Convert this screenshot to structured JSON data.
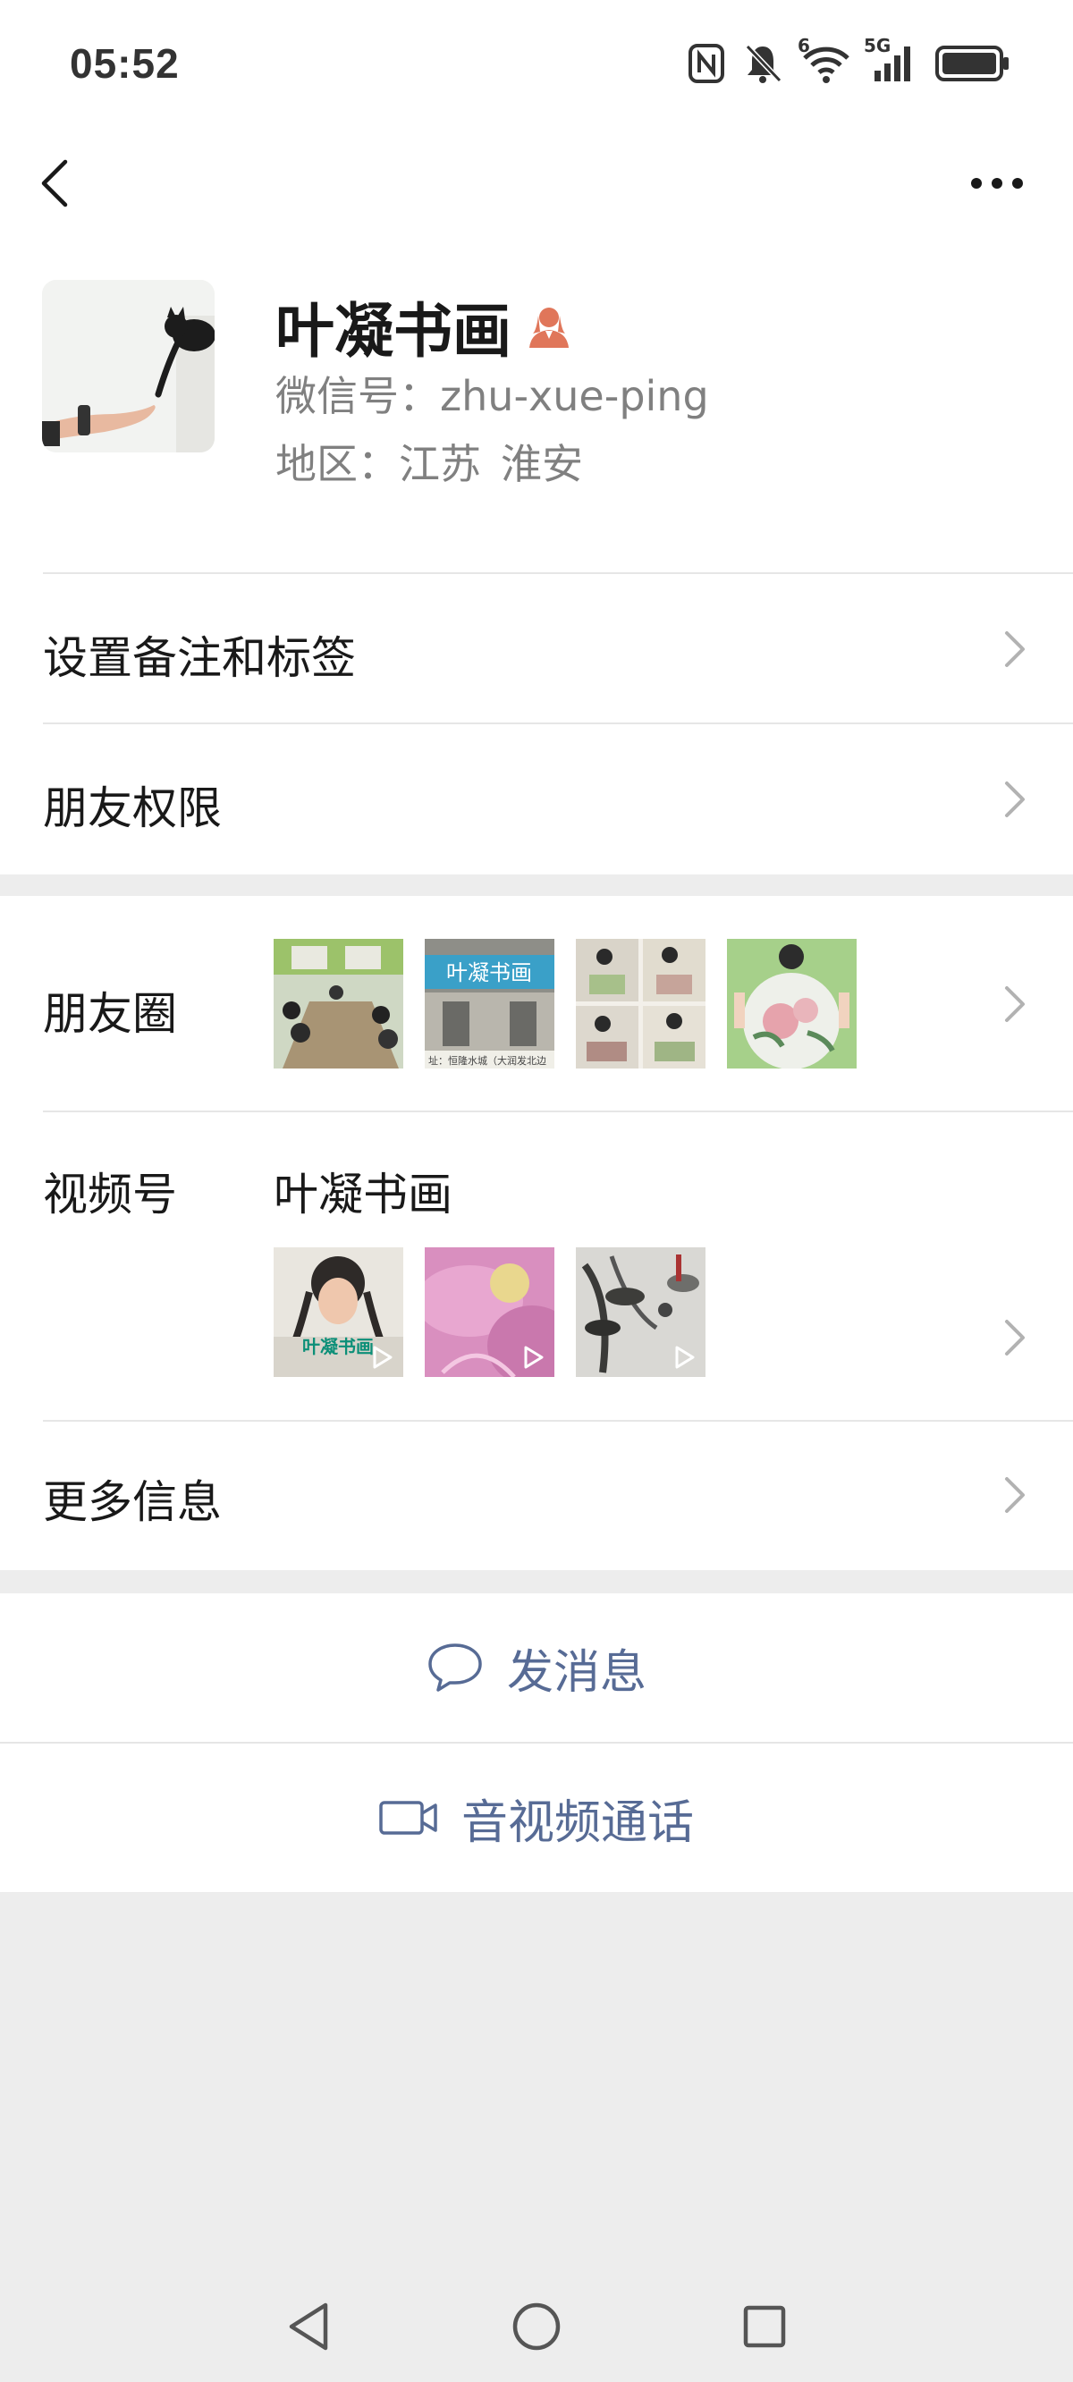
{
  "status_bar": {
    "time": "05:52",
    "icons": [
      "nfc-icon",
      "mute-icon",
      "wifi-6-icon",
      "signal-5g-icon",
      "battery-icon"
    ],
    "wifi_badge": "6",
    "network_label": "5G"
  },
  "nav": {
    "back_icon": "back-chevron-icon",
    "more_icon": "more-dots-icon"
  },
  "profile": {
    "name": "叶凝书画",
    "gender_icon": "female-user-icon",
    "wechat_id": "微信号：zhu-xue-ping",
    "region_label": "地区：",
    "region_province": "江苏",
    "region_city": "淮安"
  },
  "rows": {
    "remark": "设置备注和标签",
    "permissions": "朋友权限",
    "moments": "朋友圈",
    "channels": "视频号",
    "channels_name": "叶凝书画",
    "more_info": "更多信息"
  },
  "moments_thumbs": {
    "thumb2_sign": "叶凝书画",
    "thumb2_caption": "址：恒隆水城（大润发北边"
  },
  "channel_thumbs": {
    "thumb1_text": "叶凝书画"
  },
  "actions": {
    "message": "发消息",
    "call": "音视频通话"
  },
  "colors": {
    "accent": "#576b95",
    "background": "#ededed",
    "text": "#191919",
    "secondary_text": "#808080",
    "female_icon": "#e0765a"
  }
}
